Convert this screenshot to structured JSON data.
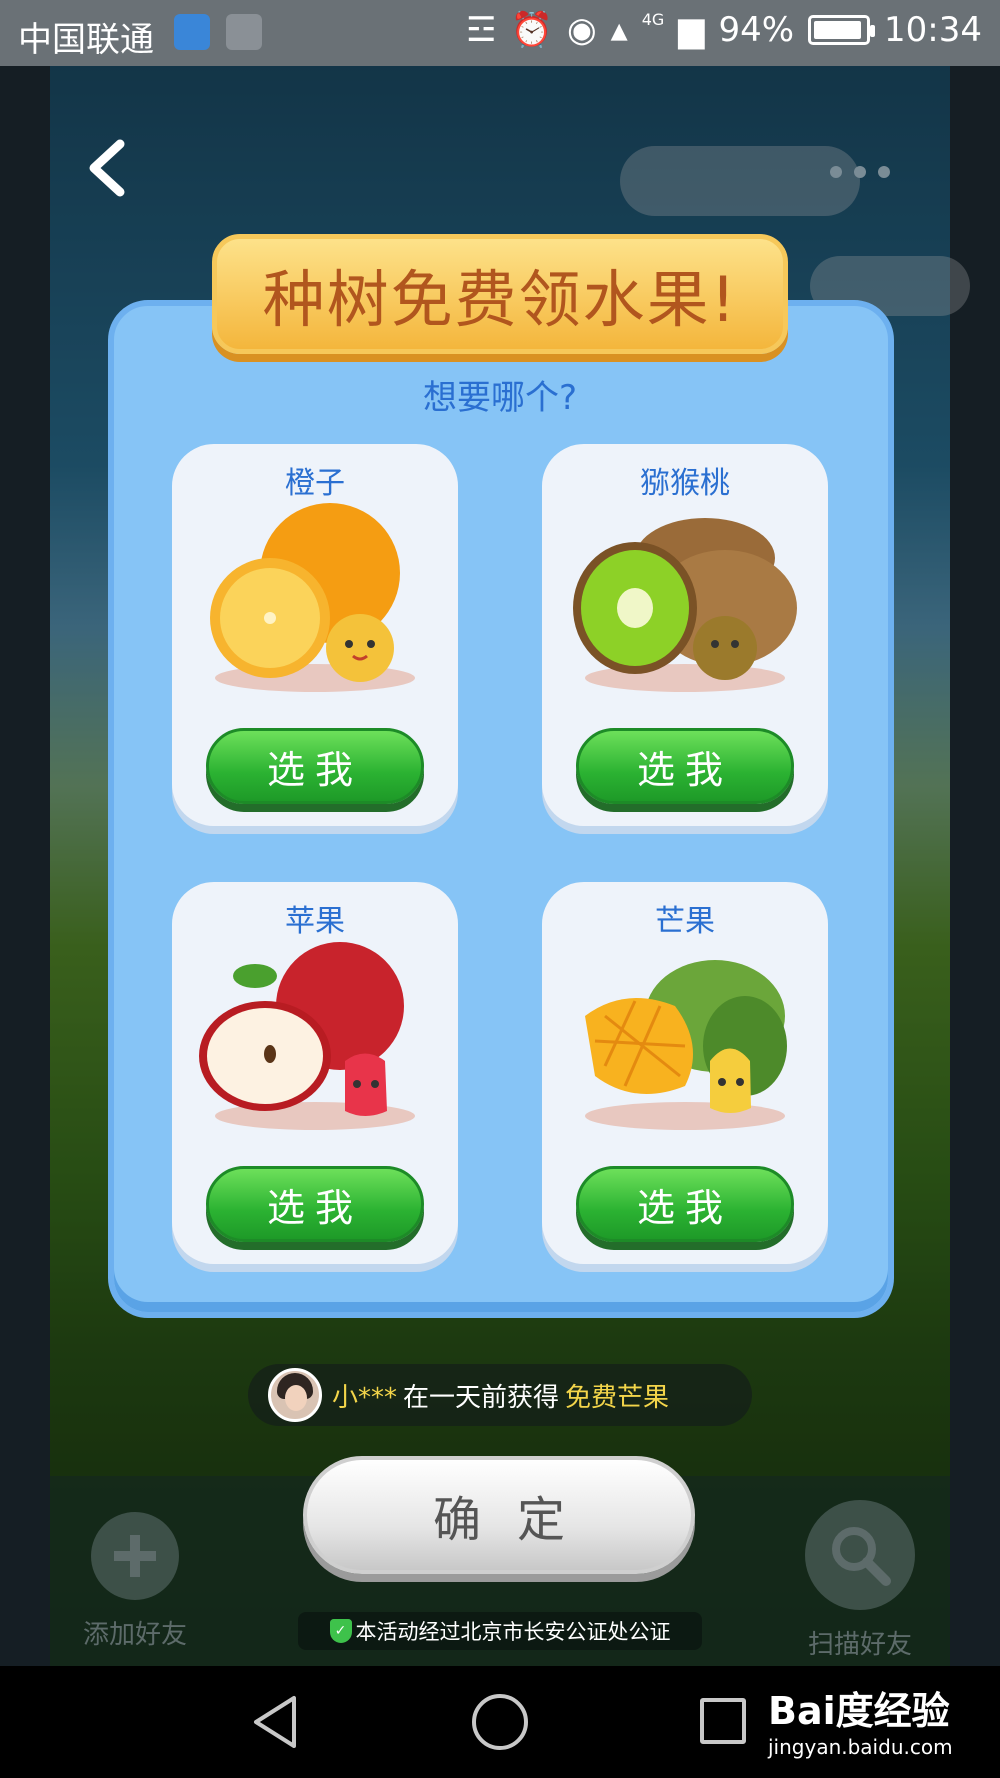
{
  "status_bar": {
    "carrier": "中国联通",
    "battery_text": "94%",
    "battery_level": 0.94,
    "network": "4G",
    "time": "10:34"
  },
  "header": {
    "banner_title": "种树免费领水果!",
    "subtitle": "想要哪个?"
  },
  "fruits": [
    {
      "name": "橙子",
      "button": "选我"
    },
    {
      "name": "猕猴桃",
      "button": "选我"
    },
    {
      "name": "苹果",
      "button": "选我"
    },
    {
      "name": "芒果",
      "button": "选我"
    }
  ],
  "ticker": {
    "user": "小***",
    "message": "在一天前获得",
    "prize": "免费芒果"
  },
  "confirm_button": "确定",
  "notary_text": "本活动经过北京市长安公证处公证",
  "bottom_bar": {
    "add_friend": "添加好友",
    "scan_friend": "扫描好友"
  },
  "watermark": {
    "brand": "Bai度经验",
    "url": "jingyan.baidu.com"
  }
}
